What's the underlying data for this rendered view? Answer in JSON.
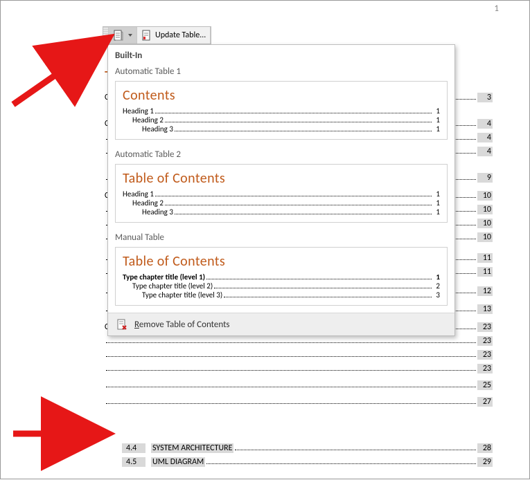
{
  "page_number": "1",
  "contents_letter": "T",
  "toolbar": {
    "update_label": "Update Table..."
  },
  "gallery": {
    "section": "Built-In",
    "auto1": {
      "title": "Automatic Table 1",
      "heading": "Contents",
      "rows": [
        {
          "label": "Heading 1",
          "page": "1",
          "indent": 0
        },
        {
          "label": "Heading 2",
          "page": "1",
          "indent": 1
        },
        {
          "label": "Heading 3",
          "page": "1",
          "indent": 2
        }
      ]
    },
    "auto2": {
      "title": "Automatic Table 2",
      "heading": "Table of Contents",
      "rows": [
        {
          "label": "Heading 1",
          "page": "1",
          "indent": 0
        },
        {
          "label": "Heading 2",
          "page": "1",
          "indent": 1
        },
        {
          "label": "Heading 3",
          "page": "1",
          "indent": 2
        }
      ]
    },
    "manual": {
      "title": "Manual Table",
      "heading": "Table of Contents",
      "rows": [
        {
          "label": "Type chapter title (level 1)",
          "page": "1",
          "indent": 0,
          "bold": true
        },
        {
          "label": "Type chapter title (level 2)",
          "page": "2",
          "indent": 1
        },
        {
          "label": "Type chapter title (level 3)",
          "page": "3",
          "indent": 2
        }
      ]
    },
    "remove_prefix": "R",
    "remove_rest": "emove Table of Contents"
  },
  "under_toc_pages": [
    "3",
    "4",
    "4",
    "4",
    "9",
    "10",
    "10",
    "10",
    "10",
    "11",
    "11",
    "12",
    "13",
    "23",
    "23",
    "23",
    "23",
    "25",
    "27"
  ],
  "under_toc_c": [
    "C",
    "C",
    "C",
    "C"
  ],
  "below": [
    {
      "num": "4.4",
      "label": "SYSTEM ARCHITECTURE",
      "page": "28"
    },
    {
      "num": "4.5",
      "label": "UML DIAGRAM",
      "page": "29"
    }
  ]
}
